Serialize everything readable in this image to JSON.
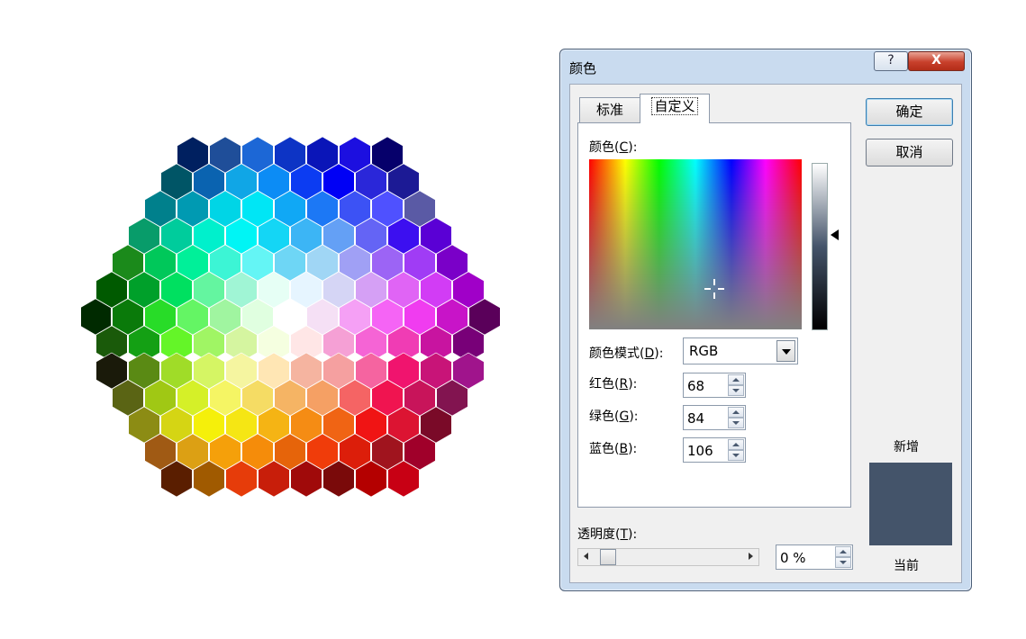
{
  "dialog": {
    "title": "颜色",
    "help_label": "?",
    "close_label": "X",
    "tabs": [
      {
        "label": "标准",
        "active": false
      },
      {
        "label": "自定义",
        "active": true
      }
    ],
    "colors_label": {
      "prefix": "颜色(",
      "key": "C",
      "suffix": "):"
    },
    "color_model": {
      "prefix": "颜色模式(",
      "key": "D",
      "suffix": "):",
      "value": "RGB"
    },
    "red": {
      "prefix": "红色(",
      "key": "R",
      "suffix": "):",
      "value": "68"
    },
    "green": {
      "prefix": "绿色(",
      "key": "G",
      "suffix": "):",
      "value": "84"
    },
    "blue": {
      "prefix": "蓝色(",
      "key": "B",
      "suffix": "):",
      "value": "106"
    },
    "transparency": {
      "prefix": "透明度(",
      "key": "T",
      "suffix": "):",
      "value": "0 %",
      "level": 0
    },
    "ok_label": "确定",
    "cancel_label": "取消",
    "new_label": "新增",
    "current_label": "当前",
    "new_color": "#44546a",
    "current_color": "#44546a"
  },
  "hex_palette": {
    "rows": [
      [
        "#002060",
        "#1f4e99",
        "#1c67d6",
        "#0d34c5",
        "#0a15b8",
        "#1c0fe0",
        "#06006b"
      ],
      [
        "#005566",
        "#0a63b0",
        "#10a6e6",
        "#0c8cf5",
        "#0c3cf2",
        "#0000f5",
        "#2a27d9",
        "#1c1a95"
      ],
      [
        "#00808c",
        "#009ab2",
        "#00d5e6",
        "#00e6f5",
        "#10a8f5",
        "#1c78f5",
        "#3c52f5",
        "#4f51ff",
        "#5a5aa5"
      ],
      [
        "#089c6a",
        "#00cc9c",
        "#00f0cc",
        "#00f5f5",
        "#14d6f5",
        "#3cb5f5",
        "#64a0f5",
        "#6464f5",
        "#3c0ff0",
        "#5a00d5"
      ],
      [
        "#1b8a1b",
        "#00c85a",
        "#00f099",
        "#3cf5d5",
        "#64f5f5",
        "#6ed6f5",
        "#a0d6f5",
        "#a0a0f5",
        "#9c64f5",
        "#a03cf5",
        "#7a00c8"
      ],
      [
        "#005a00",
        "#00a02a",
        "#00e060",
        "#64f5a0",
        "#a0f5d5",
        "#e6fff5",
        "#e6f5ff",
        "#d5d5f5",
        "#d5a0f5",
        "#e064f5",
        "#d23cf5",
        "#a000c8"
      ],
      [
        "#002a00",
        "#0a7a0a",
        "#28dc28",
        "#64f564",
        "#a0f5a0",
        "#e0ffe0",
        "#ffffff",
        "#f5e0f5",
        "#f5a0f5",
        "#f564f5",
        "#f03cf0",
        "#c814c8",
        "#5a005a"
      ],
      [
        "#1a5a0a",
        "#14a014",
        "#64f528",
        "#a0f564",
        "#d5f5a0",
        "#f5ffe0",
        "#ffe6e6",
        "#f5a0d5",
        "#f564d5",
        "#f03cb4",
        "#c814a0",
        "#780078"
      ],
      [
        "#1a1a0a",
        "#5a8a14",
        "#a0dc28",
        "#d5f564",
        "#f5f5a0",
        "#ffe6b4",
        "#f5b4a0",
        "#f5a0a0",
        "#f564a0",
        "#f0146e",
        "#c81478",
        "#a0148c"
      ],
      [
        "#5a6414",
        "#a0c814",
        "#d5f028",
        "#f5f564",
        "#f5dc64",
        "#f5b464",
        "#f5a064",
        "#f56464",
        "#f01450",
        "#c8145a",
        "#821450"
      ],
      [
        "#8c8c14",
        "#d5d514",
        "#f5f00a",
        "#f5e614",
        "#f5b414",
        "#f58c14",
        "#f06414",
        "#f01414",
        "#dc1432",
        "#7a0a28"
      ],
      [
        "#a05a14",
        "#dca014",
        "#f5a00a",
        "#f58c0a",
        "#e6640a",
        "#f03c0a",
        "#dc1e0a",
        "#a0141e",
        "#a0002a"
      ],
      [
        "#5a1e00",
        "#a05a00",
        "#e63c0a",
        "#c81e0a",
        "#a00a0a",
        "#7a0a0a",
        "#b40000",
        "#c80014"
      ]
    ]
  }
}
